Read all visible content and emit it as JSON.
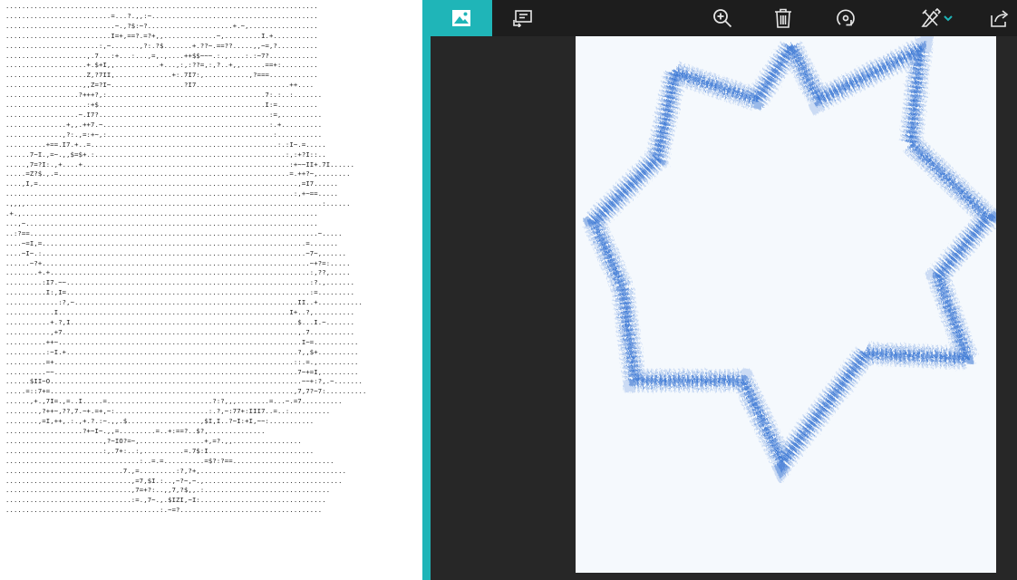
{
  "ascii_art": {
    "lines": [
      ".............................................................................",
      "..........................=...?.,,:~.........................................",
      "...........................~.,?$:~?.....................+.~,.................",
      "..........................I=+,==?.=?+,,.............~,.........I.+...........",
      ".......................:,~.......,?:.?$.......+.??~.==??.....,,~=,?..........",
      "....................,.7...:+...:...,=,.,....++$$~~~.:.,....:.:~7?............",
      "....................+.$+I,,...........+...,:,:??=,:,?..+,,......==+:.........",
      "....................Z,?7II,..............+:.7I7:,...........,?===............",
      "...................,,Z=?I~..................?I7.......................++....",
      "..................?+++?,:.......................................7:.:..:.......",
      "....................:+$.........................................I:=..........",
      "..................~.I7?..........................................:=,..........",
      "...............+,,.++7.~.........................................:.+..........",
      "..............,?:.,=:+~,:.........................................:...........",
      "..........+==.I7.+..=..............................................:.:I~.=.....",
      "......7~I.,=~.,,$=$+.:...............................................:,:+?I::..",
      ".....,7=?I:.,+....+...................................................:+~~II+.7I......",
      ".....=Z?$.,.=.........................................................=.++?~,........",
      "....,I,=................................................................,=I7......",
      ".......................................................................:,+~==.....",
      ".,,,,.........................................................................:......",
      ".+.,.........................................................................",
      "...,~........................................................................",
      "..:?==.......................................................................~.....",
      "....~=I,=.................................................................=.......",
      "....~I~.:.................................................................~7~,......",
      "......~?+..................................................................~+?=:.....",
      "........+.+................................................................:,??,.....",
      ".........:I7.~~............................................................:?.,.......",
      "..........I:,I=............................................................:=.........",
      ".............:?,~.......................................................II..+...........",
      "............I.........................................................I+..?,..........",
      "...........+.?,I........................................................$...I.~.......",
      "...........,+7..........................................................,.7...........",
      "..........++~............................................................I~=...........",
      "..........:~I.+.........................................................?,,$+..........",
      "..........=+...........................................................::.=.,..........",
      "..........~~............................................................7~+=I,.........",
      "......$II~O..............................................................~~+:?,.~.......",
      ".....=::7+=............................................................,7,7?~7:..........",
      "......,+.,7I=.,=..I.....=..........................?:?,,,........=...~.=7..........",
      "........,?++~,??,7.~+.=+,~:.......................:.?,~:77+:III7..=..:..........",
      "........,=I,++,.:.,+.?.:~.,,.$..................,$I,I..?~I:+I,~~:...........",
      "...................?+~I~.,,=.........=..+:==?..$?,..............",
      "........................,?~IO?=~,................+,=?.,,.................",
      "........................:,.7+:..:,..........=.7$:I..........................",
      ".................................:..=.=..........=$?:?==.........................",
      ".............................7.,=.........:?,?+,....................................",
      "...............................,=7,$I.:..,~?~,~.,..................................",
      "...............................,7=+?:..,,7,?$,,.:...............................",
      "...............................:=.,7~.,.$IZI,~I:...............................",
      "......................................:.~=?..................................."
    ]
  },
  "toolbar": {
    "photo_icon": "image-icon",
    "slideshow_icon": "slideshow-icon",
    "zoom_icon": "zoom-in-icon",
    "delete_icon": "trash-icon",
    "rotate_icon": "rotate-icon",
    "edit_icon": "edit-tools-icon",
    "share_icon": "share-icon"
  },
  "colors": {
    "accent": "#1fb5b8",
    "viewer_background": "#272727",
    "toolbar_background": "#1d1d1d",
    "star_ink": "#2f6fd1"
  }
}
